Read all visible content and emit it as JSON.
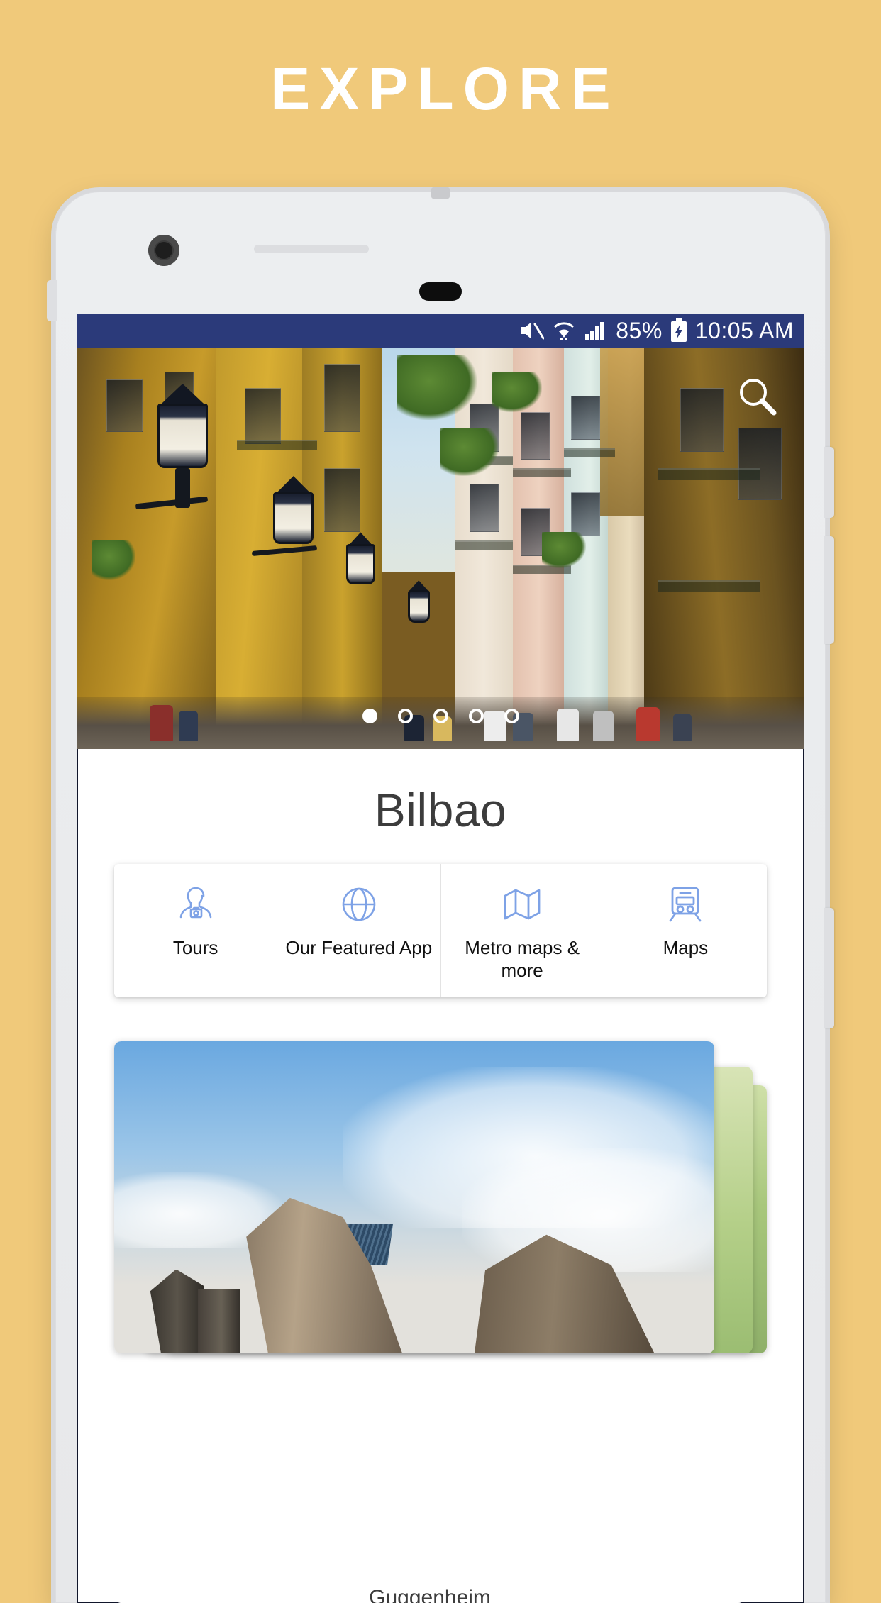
{
  "headline": "EXPLORE",
  "theme": {
    "background": "#f0c97a",
    "status_bar": "#2b3a7a",
    "accent_icon": "#6f94e0",
    "title_color": "#ffffff"
  },
  "phone": {
    "camera": "front-camera",
    "speaker": "earpiece-speaker",
    "home_button": "home-button"
  },
  "status_bar": {
    "mute_icon": "mute-icon",
    "wifi_icon": "wifi-icon",
    "signal_icon": "cellular-signal-icon",
    "battery_percent": "85%",
    "battery_icon": "battery-charging-icon",
    "time": "10:05 AM"
  },
  "hero": {
    "search_icon": "search-icon",
    "alt": "Old town street with ochre buildings and ornate street lamps",
    "carousel": {
      "total": 5,
      "active_index": 0
    }
  },
  "city": {
    "name": "Bilbao"
  },
  "quick_actions": [
    {
      "label": "Tours",
      "icon": "tourist-with-camera-icon"
    },
    {
      "label": "Our Featured App",
      "icon": "globe-icon"
    },
    {
      "label": "Metro maps & more",
      "icon": "folded-map-icon"
    },
    {
      "label": "Maps",
      "icon": "metro-train-icon"
    }
  ],
  "featured_deck": {
    "front_alt": "Guggenheim Museum Bilbao",
    "caption": "Guggenheim"
  }
}
